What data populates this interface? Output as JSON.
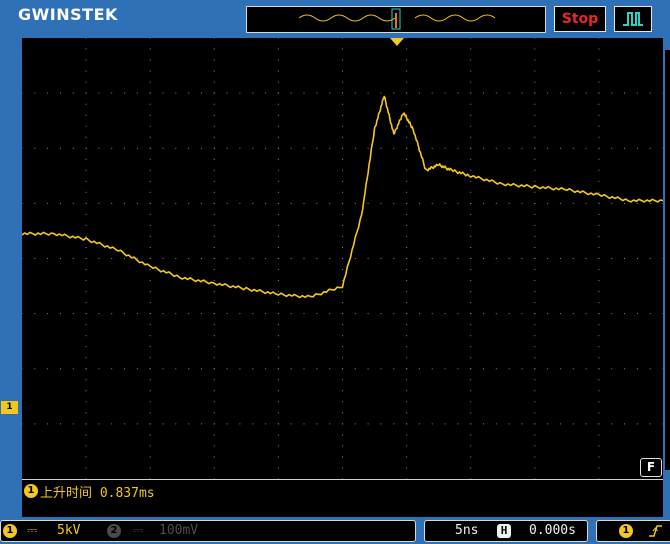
{
  "brand": "GWINSTEK",
  "run_state": "Stop",
  "trigger_type_icon": "pulse-trigger-icon",
  "colors": {
    "ch1": "#f2c81f",
    "stop": "#e8272a",
    "frame": "#2f71b6",
    "trigger_mode": "#2fd1c4"
  },
  "channel1": {
    "marker": "1",
    "coupling_icon": "dc-coupling-icon",
    "scale": "5kV"
  },
  "channel2": {
    "marker": "2",
    "coupling_icon": "dc-coupling-icon",
    "scale": "100mV",
    "enabled": false
  },
  "measurement": {
    "channel": "1",
    "label": "上升时间 0.837ms"
  },
  "timebase": {
    "scale": "5ns",
    "mode_marker": "H",
    "position": "0.000s"
  },
  "trigger": {
    "source": "1",
    "slope_icon": "rising-edge-icon"
  },
  "filter_marker": "F",
  "chart_data": {
    "type": "line",
    "title": "",
    "xlabel": "",
    "ylabel": "",
    "grid": true,
    "x_divisions": 10,
    "y_divisions": 8,
    "xlim": [
      0,
      10
    ],
    "ylim": [
      -4,
      4
    ],
    "series": [
      {
        "values_x": [
          0,
          0.5,
          1,
          1.5,
          2,
          2.5,
          3,
          3.5,
          4,
          4.5,
          5,
          5.3,
          5.5,
          5.65,
          5.8,
          5.95,
          6.1,
          6.3,
          6.5,
          6.7,
          7,
          7.5,
          8,
          8.5,
          9,
          9.5,
          10
        ],
        "values_y": [
          0.45,
          0.45,
          0.35,
          0.15,
          -0.15,
          -0.35,
          -0.45,
          -0.55,
          -0.65,
          -0.7,
          -0.5,
          0.8,
          2.35,
          2.95,
          2.25,
          2.65,
          2.35,
          1.6,
          1.7,
          1.6,
          1.5,
          1.35,
          1.3,
          1.25,
          1.15,
          1.05,
          1.05
        ]
      }
    ]
  }
}
